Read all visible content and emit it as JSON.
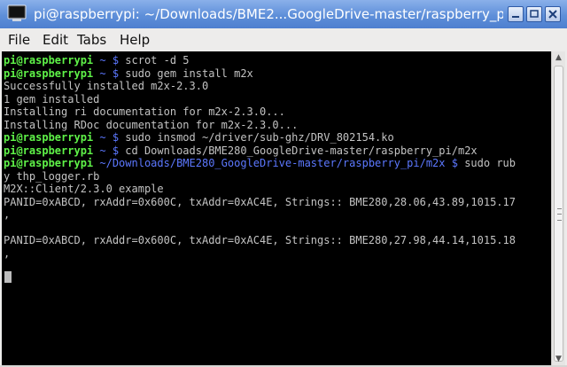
{
  "window": {
    "title": "pi@raspberrypi: ~/Downloads/BME2...GoogleDrive-master/raspberry_pi/m2x",
    "app_icon": "terminal-icon",
    "controls": [
      "minimize-icon",
      "maximize-icon",
      "close-icon"
    ]
  },
  "menu": {
    "file": "File",
    "edit": "Edit",
    "tabs": "Tabs",
    "help": "Help"
  },
  "terminal": {
    "lines": [
      {
        "user": "pi@raspberrypi",
        "path": " ~ $",
        "text": " scrot -d 5"
      },
      {
        "user": "pi@raspberrypi",
        "path": " ~ $",
        "text": " sudo gem install m2x"
      },
      {
        "text": "Successfully installed m2x-2.3.0"
      },
      {
        "text": "1 gem installed"
      },
      {
        "text": "Installing ri documentation for m2x-2.3.0..."
      },
      {
        "text": "Installing RDoc documentation for m2x-2.3.0..."
      },
      {
        "user": "pi@raspberrypi",
        "path": " ~ $",
        "text": " sudo insmod ~/driver/sub-ghz/DRV_802154.ko"
      },
      {
        "user": "pi@raspberrypi",
        "path": " ~ $",
        "text": " cd Downloads/BME280_GoogleDrive-master/raspberry_pi/m2x"
      },
      {
        "user": "pi@raspberrypi",
        "path": " ~/Downloads/BME280_GoogleDrive-master/raspberry_pi/m2x $",
        "text": " sudo rub"
      },
      {
        "text": "y thp_logger.rb"
      },
      {
        "text": "M2X::Client/2.3.0 example"
      },
      {
        "text": "PANID=0xABCD, rxAddr=0x600C, txAddr=0xAC4E, Strings:: BME280,28.06,43.89,1015.17"
      },
      {
        "text": ","
      },
      {
        "text": ""
      },
      {
        "text": "PANID=0xABCD, rxAddr=0x600C, txAddr=0xAC4E, Strings:: BME280,27.98,44.14,1015.18"
      },
      {
        "text": ","
      }
    ]
  },
  "colors": {
    "prompt_user": "#5ff348",
    "prompt_path": "#5c78ff",
    "output": "#c3c3c3",
    "background": "#000000",
    "titlebar": "#5e8fd9"
  }
}
